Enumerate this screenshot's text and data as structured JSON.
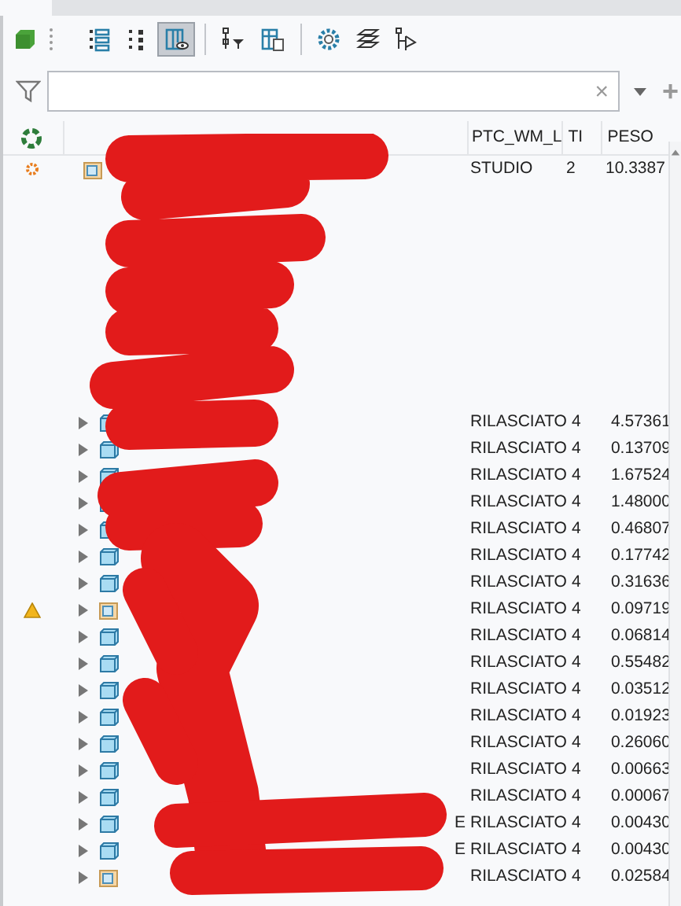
{
  "toolbar": [
    {
      "selected": false
    },
    {
      "selected": false
    },
    {
      "selected": true
    },
    {
      "selected": false
    },
    {
      "selected": false
    },
    {
      "selected": false
    },
    {
      "selected": false
    },
    {
      "selected": false
    }
  ],
  "filter": {
    "clear": "×",
    "add": "+"
  },
  "columns": [
    "PTC_WM_L",
    "TI",
    "PESO"
  ],
  "rows": [
    {
      "kind": "assembly",
      "expandable": false,
      "warning": false,
      "modified": true,
      "values": [
        "STUDIO",
        "2",
        "10.3387"
      ]
    },
    {
      "kind": "part",
      "expandable": true,
      "warning": false,
      "modified": false,
      "values": [
        "RILASCIATO",
        "4",
        "4.57361"
      ]
    },
    {
      "kind": "part",
      "expandable": true,
      "warning": false,
      "modified": false,
      "values": [
        "RILASCIATO",
        "4",
        "0.13709"
      ]
    },
    {
      "kind": "part",
      "expandable": true,
      "warning": false,
      "modified": false,
      "values": [
        "RILASCIATO",
        "4",
        "1.67524"
      ]
    },
    {
      "kind": "part",
      "expandable": true,
      "warning": false,
      "modified": false,
      "values": [
        "RILASCIATO",
        "4",
        "1.48000"
      ]
    },
    {
      "kind": "part",
      "expandable": true,
      "warning": false,
      "modified": false,
      "values": [
        "RILASCIATO",
        "4",
        "0.46807"
      ]
    },
    {
      "kind": "part",
      "expandable": true,
      "warning": false,
      "modified": false,
      "values": [
        "RILASCIATO",
        "4",
        "0.17742"
      ]
    },
    {
      "kind": "part",
      "expandable": true,
      "warning": false,
      "modified": false,
      "values": [
        "RILASCIATO",
        "4",
        "0.31636"
      ]
    },
    {
      "kind": "assembly",
      "expandable": true,
      "warning": true,
      "modified": false,
      "values": [
        "RILASCIATO",
        "4",
        "0.09719"
      ]
    },
    {
      "kind": "part",
      "expandable": true,
      "warning": false,
      "modified": false,
      "values": [
        "RILASCIATO",
        "4",
        "0.06814"
      ]
    },
    {
      "kind": "part",
      "expandable": true,
      "warning": false,
      "modified": false,
      "values": [
        "RILASCIATO",
        "4",
        "0.55482"
      ]
    },
    {
      "kind": "part",
      "expandable": true,
      "warning": false,
      "modified": false,
      "values": [
        "RILASCIATO",
        "4",
        "0.03512"
      ]
    },
    {
      "kind": "part",
      "expandable": true,
      "warning": false,
      "modified": false,
      "values": [
        "RILASCIATO",
        "4",
        "0.01923"
      ]
    },
    {
      "kind": "part",
      "expandable": true,
      "warning": false,
      "modified": false,
      "values": [
        "RILASCIATO",
        "4",
        "0.26060"
      ]
    },
    {
      "kind": "part",
      "expandable": true,
      "warning": false,
      "modified": false,
      "values": [
        "RILASCIATO",
        "4",
        "0.00663"
      ]
    },
    {
      "kind": "part",
      "expandable": true,
      "warning": false,
      "modified": false,
      "values": [
        "RILASCIATO",
        "4",
        "0.00067"
      ]
    },
    {
      "kind": "part",
      "expandable": true,
      "warning": false,
      "modified": false,
      "name_tail": "E",
      "values": [
        "RILASCIATO",
        "4",
        "0.00430"
      ]
    },
    {
      "kind": "part",
      "expandable": true,
      "warning": false,
      "modified": false,
      "name_tail": "E",
      "values": [
        "RILASCIATO",
        "4",
        "0.00430"
      ]
    },
    {
      "kind": "assembly",
      "expandable": true,
      "warning": false,
      "modified": false,
      "values": [
        "RILASCIATO",
        "4",
        "0.02584"
      ]
    }
  ]
}
